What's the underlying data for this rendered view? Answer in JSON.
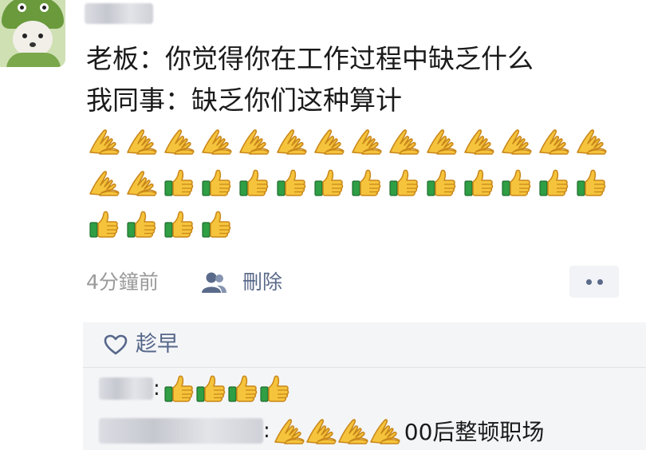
{
  "post": {
    "line1": "老板：你觉得你在工作过程中缺乏什么",
    "line2": "我同事：缺乏你们这种算计",
    "emoji_rows": [
      [
        "pinch",
        "pinch",
        "pinch",
        "pinch",
        "pinch",
        "pinch",
        "pinch",
        "pinch",
        "pinch",
        "pinch",
        "pinch",
        "pinch",
        "pinch",
        "pinch"
      ],
      [
        "pinch",
        "pinch",
        "thumbs-up",
        "thumbs-up",
        "thumbs-up",
        "thumbs-up",
        "thumbs-up",
        "thumbs-up",
        "thumbs-up",
        "thumbs-up",
        "thumbs-up",
        "thumbs-up",
        "thumbs-up",
        "thumbs-up"
      ],
      [
        "thumbs-up",
        "thumbs-up",
        "thumbs-up",
        "thumbs-up"
      ]
    ],
    "time": "4分鐘前",
    "delete_label": "刪除"
  },
  "likes": {
    "names": "趁早"
  },
  "comments": [
    {
      "colon": ":",
      "emojis": [
        "thumbs-up",
        "thumbs-up",
        "thumbs-up",
        "thumbs-up"
      ],
      "text": ""
    },
    {
      "colon": ":",
      "emojis": [
        "pinch",
        "pinch",
        "pinch",
        "pinch"
      ],
      "text": "00后整顿职场"
    }
  ],
  "colors": {
    "link": "#56678a",
    "meta": "#9a9a9a",
    "panel_bg": "#f4f5f7"
  },
  "icons": [
    "person-icon",
    "more-dots-icon",
    "heart-icon",
    "pinch-emoji-icon",
    "thumbs-up-emoji-icon"
  ]
}
